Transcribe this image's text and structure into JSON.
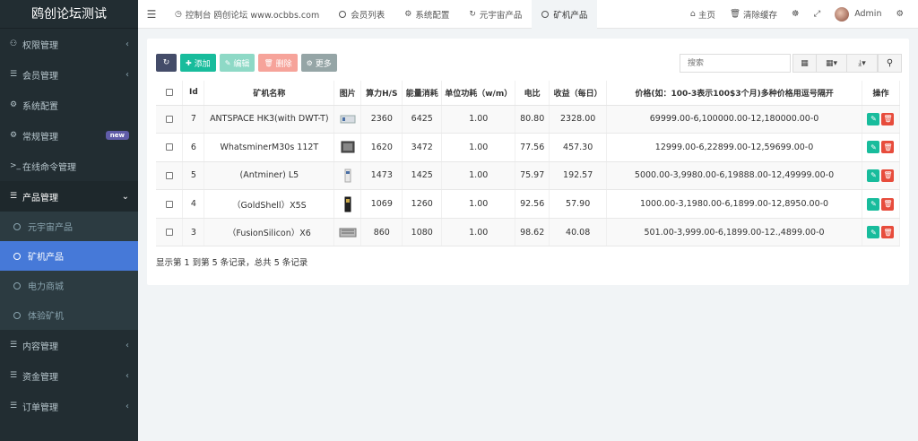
{
  "app": {
    "title": "鸥创论坛测试"
  },
  "sidebar": {
    "items": [
      {
        "label": "权限管理",
        "icon": "users-icon"
      },
      {
        "label": "会员管理",
        "icon": "list-icon"
      },
      {
        "label": "系统配置",
        "icon": "gear-icon"
      },
      {
        "label": "常规管理",
        "icon": "cogs-icon",
        "badge": "new"
      },
      {
        "label": "在线命令管理",
        "icon": "terminal-icon"
      },
      {
        "label": "产品管理",
        "icon": "list-icon"
      },
      {
        "label": "内容管理",
        "icon": "list-icon"
      },
      {
        "label": "资金管理",
        "icon": "list-icon"
      },
      {
        "label": "订单管理",
        "icon": "list-icon"
      }
    ],
    "submenu": [
      "元宇宙产品",
      "矿机产品",
      "电力商城",
      "体验矿机"
    ]
  },
  "topnav": {
    "tabs": [
      {
        "label": "控制台 鸥创论坛 www.ocbbs.com"
      },
      {
        "label": "会员列表"
      },
      {
        "label": "系统配置"
      },
      {
        "label": "元宇宙产品"
      },
      {
        "label": "矿机产品"
      }
    ],
    "right": {
      "home": "主页",
      "clear_cache": "清除缓存",
      "user": "Admin"
    }
  },
  "toolbar": {
    "add": "添加",
    "edit": "编辑",
    "delete": "删除",
    "more": "更多",
    "search_placeholder": "搜索"
  },
  "table": {
    "headers": [
      "Id",
      "矿机名称",
      "图片",
      "算力H/S",
      "能量消耗",
      "单位功耗（w/m）",
      "电比",
      "收益（每日）",
      "价格(如：100-3表示100$3个月)多种价格用逗号隔开",
      "操作"
    ],
    "rows": [
      {
        "id": "7",
        "name": "ANTSPACE HK3(with DWT-T)",
        "hashrate": "2360",
        "energy": "6425",
        "unit_power": "1.00",
        "ratio": "80.80",
        "income": "2328.00",
        "price": "69999.00-6,100000.00-12,180000.00-0"
      },
      {
        "id": "6",
        "name": "WhatsminerM30s 112T",
        "hashrate": "1620",
        "energy": "3472",
        "unit_power": "1.00",
        "ratio": "77.56",
        "income": "457.30",
        "price": "12999.00-6,22899.00-12,59699.00-0"
      },
      {
        "id": "5",
        "name": "(Antminer) L5",
        "hashrate": "1473",
        "energy": "1425",
        "unit_power": "1.00",
        "ratio": "75.97",
        "income": "192.57",
        "price": "5000.00-3,9980.00-6,19888.00-12,49999.00-0"
      },
      {
        "id": "4",
        "name": "（GoldShell）X5S",
        "hashrate": "1069",
        "energy": "1260",
        "unit_power": "1.00",
        "ratio": "92.56",
        "income": "57.90",
        "price": "1000.00-3,1980.00-6,1899.00-12,8950.00-0"
      },
      {
        "id": "3",
        "name": "（FusionSilicon）X6",
        "hashrate": "860",
        "energy": "1080",
        "unit_power": "1.00",
        "ratio": "98.62",
        "income": "40.08",
        "price": "501.00-3,999.00-6,1899.00-12.,4899.00-0"
      }
    ],
    "footer": "显示第 1 到第 5 条记录，总共 5 条记录"
  },
  "colors": {
    "sidebar_bg": "#222d32",
    "active_sub": "#4679d8",
    "green": "#18bc9c",
    "red": "#e74c3c"
  }
}
